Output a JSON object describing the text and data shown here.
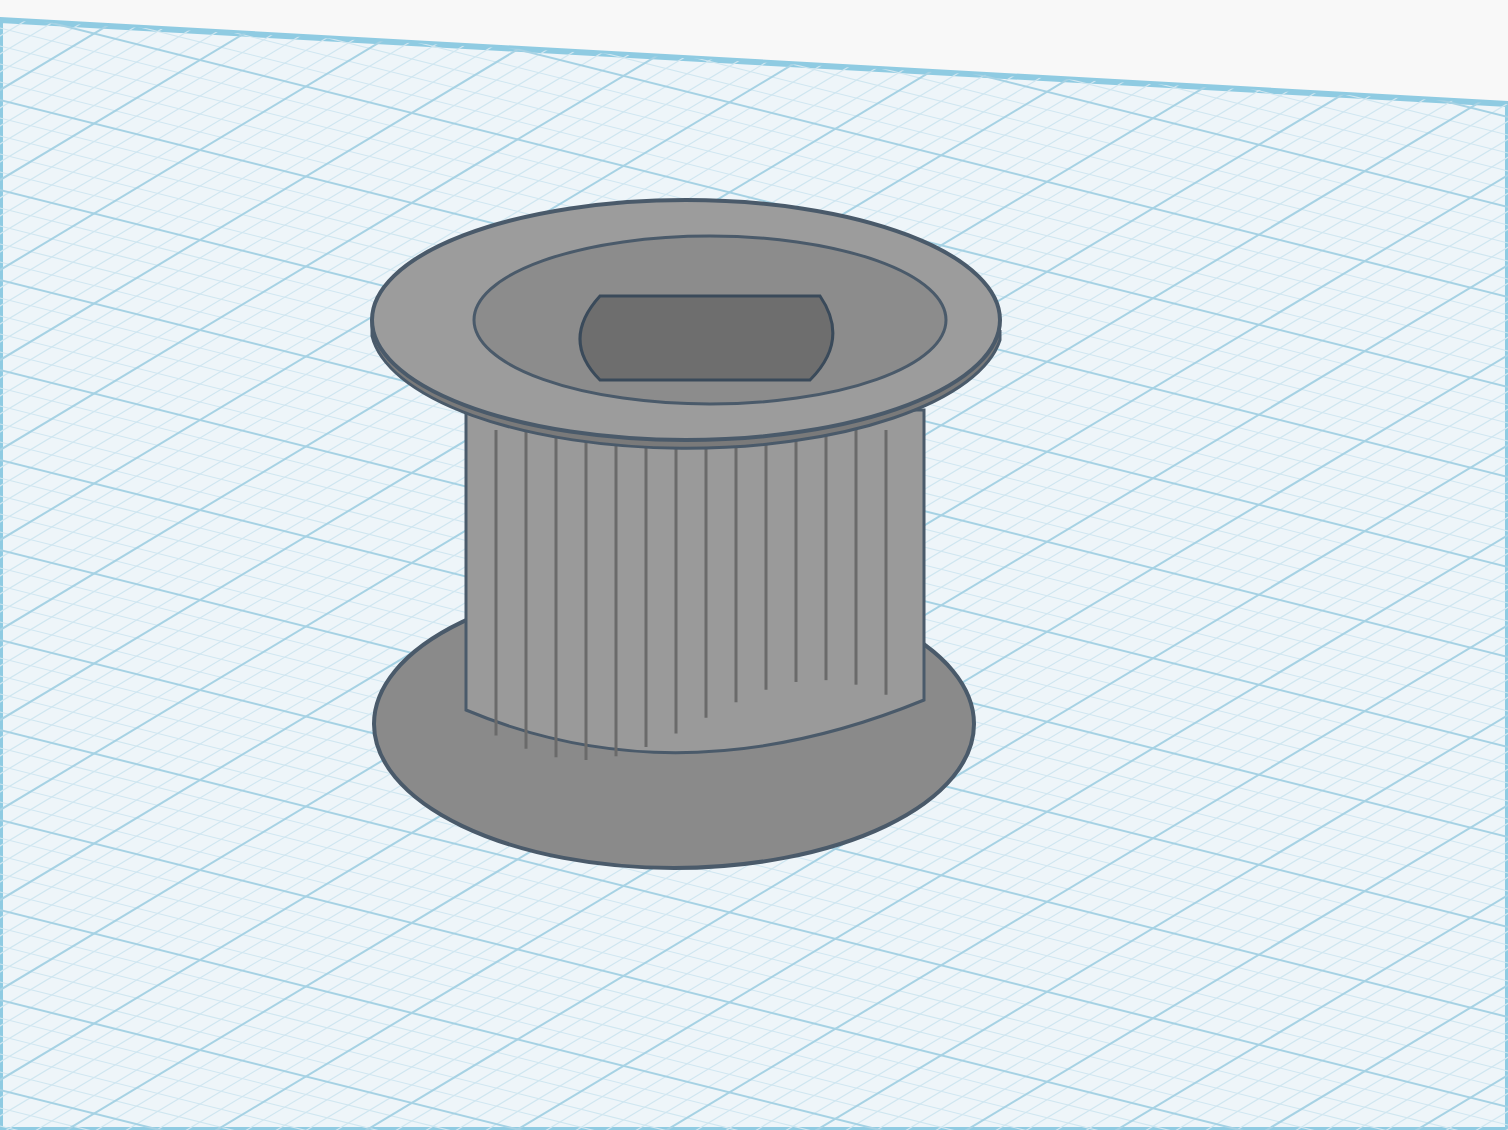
{
  "scene": {
    "objects": [
      {
        "kind": "pulley"
      }
    ]
  }
}
